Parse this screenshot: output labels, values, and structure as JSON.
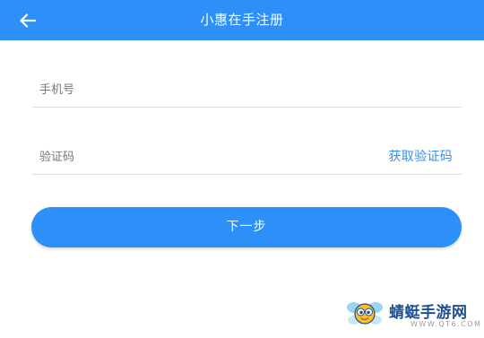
{
  "header": {
    "title": "小惠在手注册",
    "back_icon": "arrow-left-icon",
    "background": "#2d90f8"
  },
  "form": {
    "phone": {
      "placeholder": "手机号",
      "value": ""
    },
    "code": {
      "placeholder": "验证码",
      "value": "",
      "get_code_label": "获取验证码"
    }
  },
  "next_button": {
    "label": "下一步"
  },
  "watermark": {
    "name": "蜻蜓手游网",
    "domain": "WWW.QT6.COM",
    "icon": "dragonfly-logo-icon"
  }
}
